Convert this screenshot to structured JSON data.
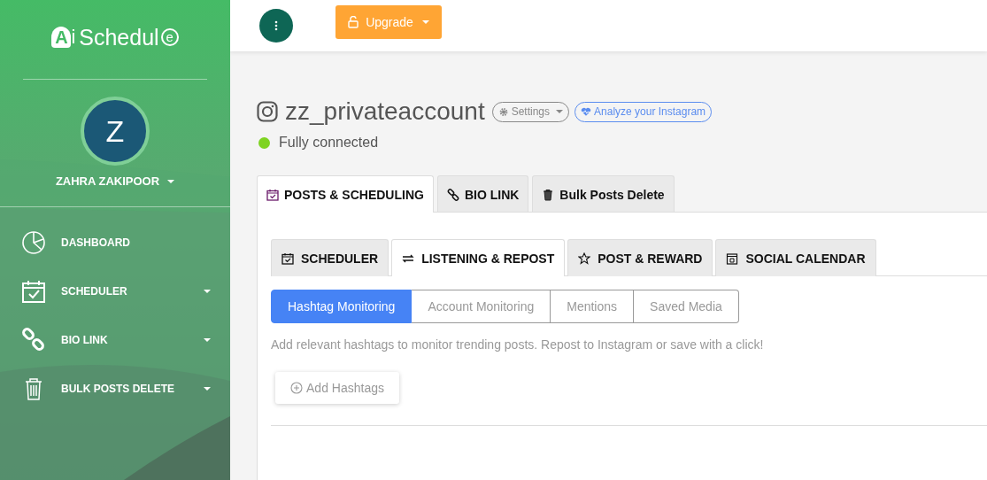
{
  "sidebar": {
    "logo": {
      "mark": "A",
      "mark_suffix": "i",
      "text": "Schedul",
      "end": "e"
    },
    "avatar": "Z",
    "user_name": "ZAHRA ZAKIPOOR",
    "items": [
      {
        "label": "DASHBOARD",
        "kind": "chart",
        "expandable": false
      },
      {
        "label": "SCHEDULER",
        "kind": "calendar",
        "expandable": true
      },
      {
        "label": "BIO LINK",
        "kind": "link",
        "expandable": true
      },
      {
        "label": "BULK POSTS DELETE",
        "kind": "trash",
        "expandable": true
      }
    ]
  },
  "topbar": {
    "upgrade": "Upgrade"
  },
  "account": {
    "name": "zz_privateaccount",
    "settings": "Settings",
    "analyze": "Analyze your Instagram",
    "status": "Fully connected"
  },
  "tabs": [
    {
      "label": "POSTS & SCHEDULING",
      "kind": "calendar",
      "selected": true
    },
    {
      "label": "BIO LINK",
      "kind": "link",
      "selected": false
    },
    {
      "label": "Bulk Posts Delete",
      "kind": "trash",
      "selected": false
    }
  ],
  "subtabs": [
    {
      "label": "SCHEDULER",
      "kind": "calendar",
      "selected": false
    },
    {
      "label": "LISTENING & REPOST",
      "kind": "repost",
      "selected": true
    },
    {
      "label": "POST & REWARD",
      "kind": "star",
      "selected": false
    },
    {
      "label": "SOCIAL CALENDAR",
      "kind": "daycal",
      "selected": false
    }
  ],
  "segments": [
    {
      "label": "Hashtag Monitoring",
      "selected": true
    },
    {
      "label": "Account Monitoring",
      "selected": false
    },
    {
      "label": "Mentions",
      "selected": false
    },
    {
      "label": "Saved Media",
      "selected": false
    }
  ],
  "description": "Add relevant hashtags to monitor trending posts. Repost to Instagram or save with a click!",
  "add_button": "Add Hashtags"
}
